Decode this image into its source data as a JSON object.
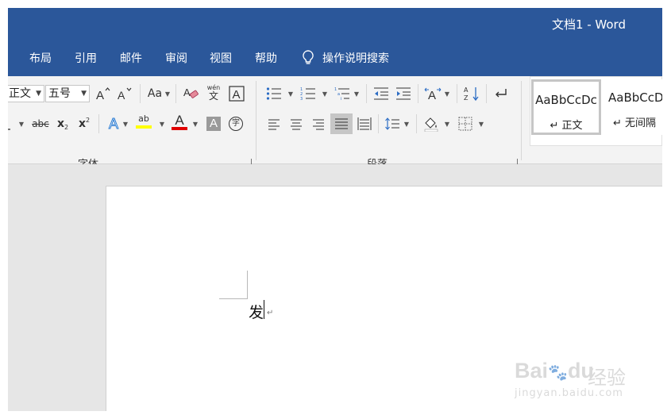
{
  "window": {
    "title": "文档1  -  Word"
  },
  "tabs": [
    "布局",
    "引用",
    "邮件",
    "审阅",
    "视图",
    "帮助"
  ],
  "tell_me": {
    "label": "操作说明搜索",
    "icon": "lightbulb-icon"
  },
  "font_group": {
    "label": "字体",
    "font_name": "正文",
    "font_size": "五号",
    "change_case": "Aa",
    "strikethrough": "abc",
    "subscript": "x",
    "superscript": "x",
    "text_effects": "A",
    "highlight_letters": "ab",
    "font_color_letter": "A",
    "char_shading_letter": "A",
    "enclose_char": "字",
    "phonetic_top": "wén",
    "phonetic_bottom": "文",
    "highlight_color": "#ffff00",
    "font_color": "#e00000"
  },
  "paragraph_group": {
    "label": "段落"
  },
  "styles": [
    {
      "sample": "AaBbCcDc",
      "name": "↵ 正文"
    },
    {
      "sample": "AaBbCcD",
      "name": "↵ 无间隔"
    }
  ],
  "document": {
    "text": "发",
    "paragraph_mark": "↵"
  },
  "watermark": {
    "logo": "Bai",
    "logo_suffix": "du",
    "text": "经验",
    "url": "jingyan.baidu.com"
  },
  "colors": {
    "accent": "#2b579a",
    "ribbon": "#f3f3f3",
    "canvas": "#e6e6e6"
  }
}
